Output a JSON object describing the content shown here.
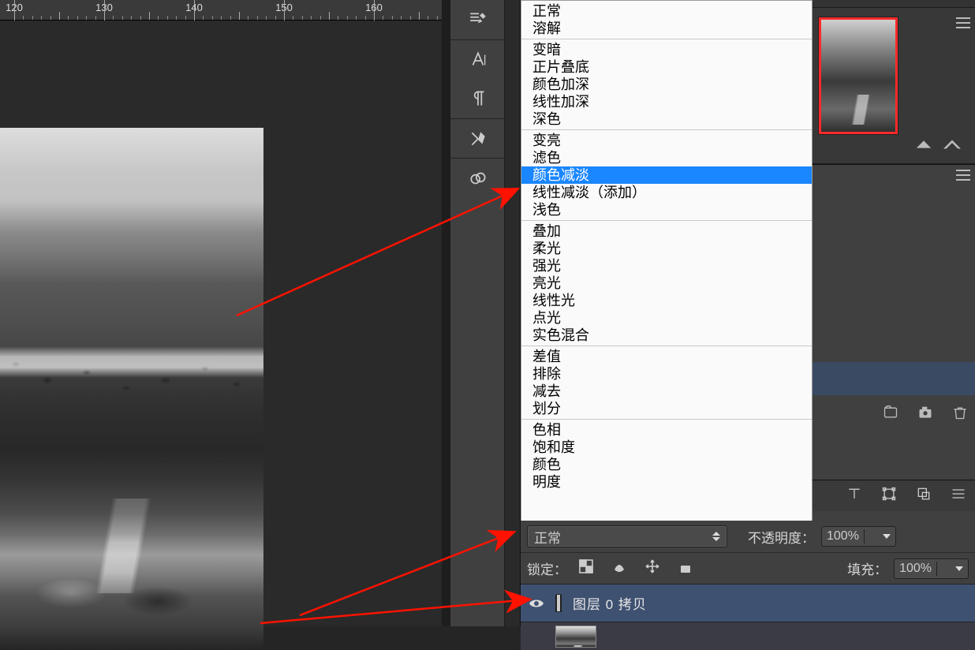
{
  "ruler": {
    "ticks": [
      120,
      130,
      140,
      150,
      160
    ]
  },
  "blend_modes": {
    "groups": [
      [
        "正常",
        "溶解"
      ],
      [
        "变暗",
        "正片叠底",
        "颜色加深",
        "线性加深",
        "深色"
      ],
      [
        "变亮",
        "滤色",
        "颜色减淡",
        "线性减淡（添加）",
        "浅色"
      ],
      [
        "叠加",
        "柔光",
        "强光",
        "亮光",
        "线性光",
        "点光",
        "实色混合"
      ],
      [
        "差值",
        "排除",
        "减去",
        "划分"
      ],
      [
        "色相",
        "饱和度",
        "颜色",
        "明度"
      ]
    ],
    "selected": "颜色减淡"
  },
  "layers_panel": {
    "mode_value": "正常",
    "opacity_label": "不透明度：",
    "opacity_value": "100%",
    "lock_label": "锁定：",
    "fill_label": "填充：",
    "fill_value": "100%",
    "layer_name": "图层 0 拷贝"
  }
}
